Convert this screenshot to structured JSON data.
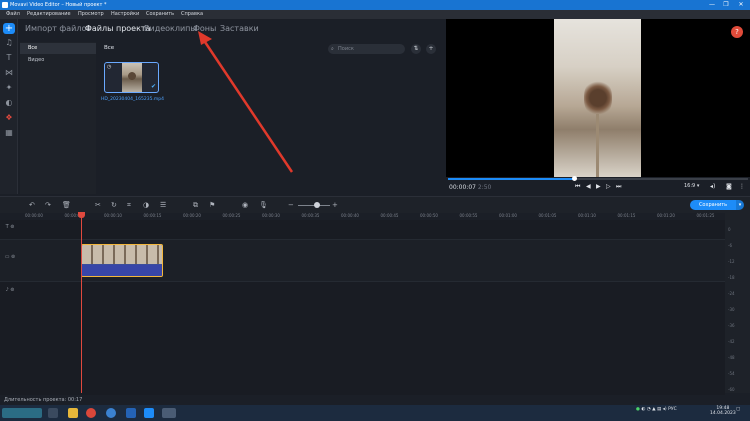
{
  "window": {
    "title": "Movavi Video Editor – Новый проект *",
    "controls": [
      "—",
      "❐",
      "✕"
    ]
  },
  "menu": [
    "Файл",
    "Редактирование",
    "Просмотр",
    "Настройки",
    "Сохранить",
    "Справка"
  ],
  "rail_icons": [
    "plus-icon",
    "music-note-icon",
    "text-icon",
    "transition-icon",
    "magic-wand-icon",
    "filter-icon",
    "sticker-icon",
    "more-tools-icon"
  ],
  "tabs": [
    {
      "label": "Импорт файлов",
      "active": false
    },
    {
      "label": "Файлы проекта",
      "active": true
    },
    {
      "label": "Видеоклипы",
      "active": false
    },
    {
      "label": "Фоны",
      "active": false
    },
    {
      "label": "Заставки",
      "active": false
    }
  ],
  "sidelist": [
    {
      "label": "Все",
      "selected": true
    },
    {
      "label": "Видео",
      "selected": false
    }
  ],
  "media": {
    "heading": "Все",
    "search_placeholder": "Поиск",
    "clip": {
      "name": "HD_20230404_165235.mp4"
    }
  },
  "preview": {
    "current": "00:00:07",
    "duration": "2:50",
    "progress": 0.42,
    "aspect": "16:9 ▾"
  },
  "toolbar": {
    "save_label": "Сохранить"
  },
  "ruler": [
    "00:00:00",
    "00:00:05",
    "00:00:10",
    "00:00:15",
    "00:00:20",
    "00:00:25",
    "00:00:30",
    "00:00:35",
    "00:00:40",
    "00:00:45",
    "00:00:50",
    "00:00:55",
    "00:01:00",
    "00:01:05",
    "00:01:10",
    "00:01:15",
    "00:01:20",
    "00:01:25"
  ],
  "vu_labels": [
    "0",
    "-6",
    "-12",
    "-18",
    "-24",
    "-30",
    "-36",
    "-42",
    "-48",
    "-54",
    "-60"
  ],
  "status": {
    "duration_text": "Длительность проекта: 00:17"
  },
  "taskbar": {
    "lang": "РУС",
    "time": "19:48",
    "date": "14.04.2023"
  },
  "colors": {
    "accent": "#1d8cf8",
    "playhead": "#e0493e",
    "clip_border": "#f3b73c",
    "annotation_arrow": "#e0392b"
  }
}
